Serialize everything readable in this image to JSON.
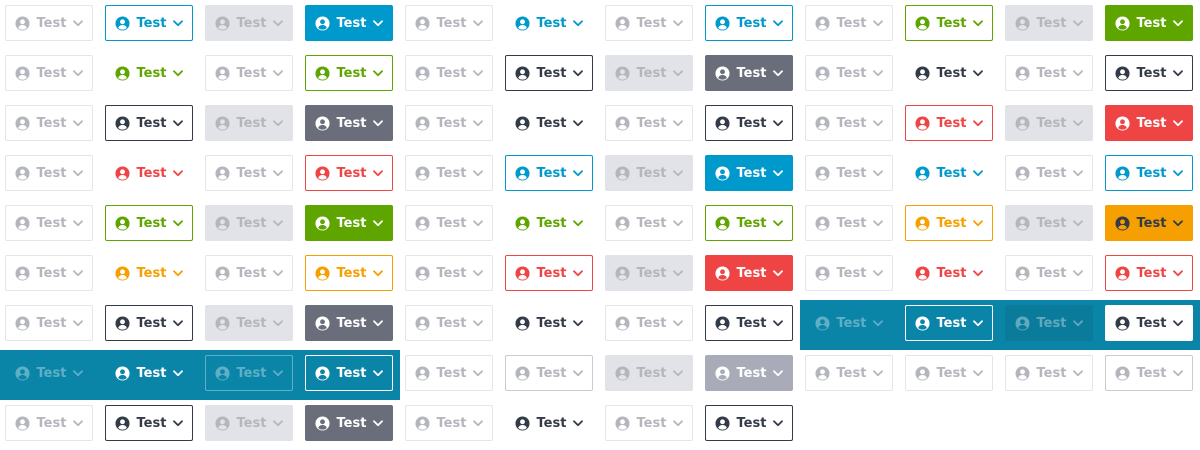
{
  "button": {
    "label": "Test",
    "icon": "user-circle-icon",
    "menu_icon": "chevron-down-icon"
  },
  "colors": {
    "primary": "#0099cc",
    "secondary": "#5ea500",
    "neutral": "#333a48",
    "neutral_fill": "#6a6e7a",
    "danger": "#ef4444",
    "warning": "#f5a000",
    "disabled_text": "#b4b6bd",
    "disabled_fill": "#e2e3e8",
    "dark_surface": "#0a85a8"
  },
  "rows": [
    [
      "dis-plain",
      "pri-outline",
      "dis-fill",
      "pri-fill",
      "dis-plain",
      "pri-plain",
      "dis-plain",
      "pri-outline",
      "dis-plain",
      "sec-outline",
      "dis-fill",
      "sec-fill"
    ],
    [
      "dis-plain",
      "sec-plain",
      "dis-plain",
      "sec-outline",
      "dis-plain",
      "neu-outline",
      "dis-fill",
      "neu-fill",
      "dis-plain",
      "neu-plain",
      "dis-plain",
      "neu-outline"
    ],
    [
      "dis-plain",
      "neu-outline",
      "dis-fill",
      "neu-fill",
      "dis-plain",
      "neu-plain",
      "dis-plain",
      "neu-outline",
      "dis-plain",
      "dan-outline",
      "dis-fill",
      "dan-fill"
    ],
    [
      "dis-plain",
      "dan-plain",
      "dis-plain",
      "dan-outline",
      "dis-plain",
      "pri-outline",
      "dis-fill",
      "pri-fill",
      "dis-plain",
      "pri-plain",
      "dis-plain",
      "pri-outline"
    ],
    [
      "dis-plain",
      "sec-outline",
      "dis-fill",
      "sec-fill",
      "dis-plain",
      "sec-plain",
      "dis-plain",
      "sec-outline",
      "dis-plain",
      "war-outline",
      "dis-fill",
      "war-fill"
    ],
    [
      "dis-plain",
      "war-plain",
      "dis-plain",
      "war-outline",
      "dis-plain",
      "dan-outline",
      "dis-fill",
      "dan-fill",
      "dis-plain",
      "dan-plain",
      "dis-plain",
      "dan-outline"
    ],
    [
      "dis-plain",
      "neu-outline",
      "dis-fill",
      "neu-fill",
      "dis-plain",
      "neu-plain",
      "dis-plain",
      "neu-outline",
      "inv-dis-plain",
      "inv-outline",
      "inv-dis-fill",
      "inv-white"
    ],
    [
      "inv-dis-plain",
      "inv-plain",
      "inv-dis-outline",
      "inv-outline",
      "dis-plain",
      "dis-outline",
      "dis-fill",
      "dis-fill-dark",
      "dis-plain",
      "dis-plain",
      "dis-plain",
      "dis-outline"
    ],
    [
      "dis-plain",
      "neu-outline",
      "dis-fill",
      "neu-fill",
      "dis-plain",
      "neu-plain",
      "dis-plain",
      "neu-outline"
    ]
  ]
}
